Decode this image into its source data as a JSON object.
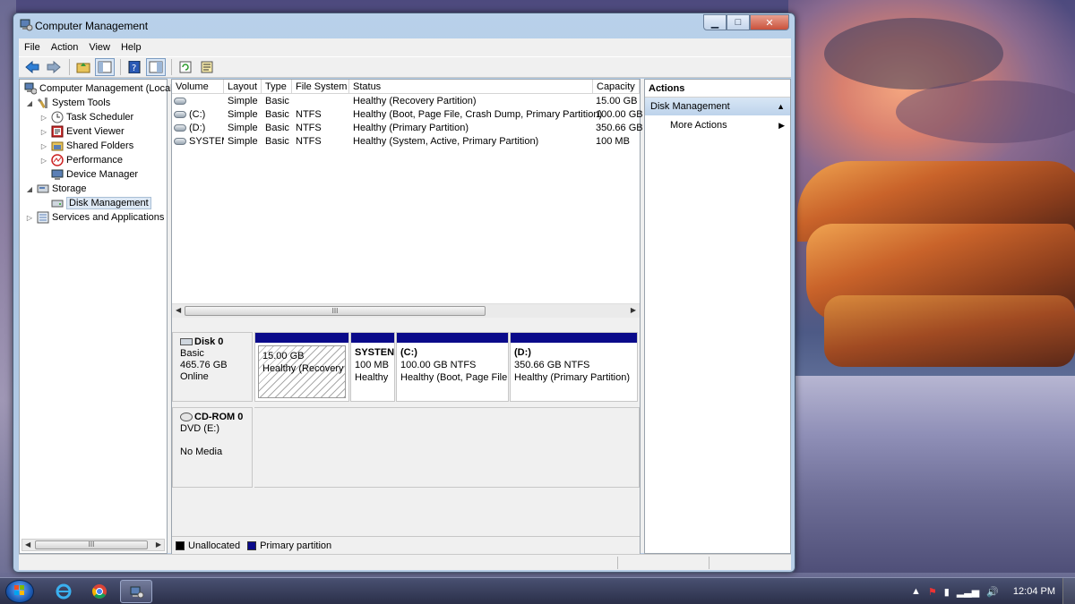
{
  "window": {
    "title": "Computer Management",
    "controls": {
      "minimize": "▁",
      "maximize": "□",
      "close": "✕"
    }
  },
  "menu": [
    "File",
    "Action",
    "View",
    "Help"
  ],
  "toolbar_icons": [
    "back-arrow-icon",
    "forward-arrow-icon",
    "up-folder-icon",
    "show-hide-tree-icon",
    "help-icon",
    "properties-icon",
    "refresh-icon",
    "export-icon"
  ],
  "tree": {
    "root": "Computer Management (Local",
    "items": [
      {
        "label": "System Tools",
        "level": 1,
        "expanded": true
      },
      {
        "label": "Task Scheduler",
        "level": 2
      },
      {
        "label": "Event Viewer",
        "level": 2
      },
      {
        "label": "Shared Folders",
        "level": 2
      },
      {
        "label": "Performance",
        "level": 2
      },
      {
        "label": "Device Manager",
        "level": 2
      },
      {
        "label": "Storage",
        "level": 1,
        "expanded": true
      },
      {
        "label": "Disk Management",
        "level": 2,
        "selected": true
      },
      {
        "label": "Services and Applications",
        "level": 1
      }
    ]
  },
  "volume_list": {
    "columns": [
      "Volume",
      "Layout",
      "Type",
      "File System",
      "Status",
      "Capacity"
    ],
    "rows": [
      {
        "volume": "",
        "layout": "Simple",
        "type": "Basic",
        "fs": "",
        "status": "Healthy (Recovery Partition)",
        "capacity": "15.00 GB"
      },
      {
        "volume": "(C:)",
        "layout": "Simple",
        "type": "Basic",
        "fs": "NTFS",
        "status": "Healthy (Boot, Page File, Crash Dump, Primary Partition)",
        "capacity": "100.00 GB"
      },
      {
        "volume": "(D:)",
        "layout": "Simple",
        "type": "Basic",
        "fs": "NTFS",
        "status": "Healthy (Primary Partition)",
        "capacity": "350.66 GB"
      },
      {
        "volume": "SYSTEM",
        "layout": "Simple",
        "type": "Basic",
        "fs": "NTFS",
        "status": "Healthy (System, Active, Primary Partition)",
        "capacity": "100 MB"
      }
    ],
    "scroll_grip": "III"
  },
  "disks": {
    "disk0": {
      "name": "Disk 0",
      "type": "Basic",
      "size": "465.76 GB",
      "state": "Online",
      "partitions": [
        {
          "line1": "",
          "line2": "15.00 GB",
          "line3": "Healthy (Recovery P"
        },
        {
          "line1": "SYSTEN",
          "line2": "100 MB",
          "line3": "Healthy"
        },
        {
          "line1": "(C:)",
          "line2": "100.00 GB NTFS",
          "line3": "Healthy (Boot, Page File,"
        },
        {
          "line1": "(D:)",
          "line2": "350.66 GB NTFS",
          "line3": "Healthy (Primary Partition)"
        }
      ]
    },
    "cdrom0": {
      "name": "CD-ROM 0",
      "type": "DVD (E:)",
      "state": "No Media"
    }
  },
  "legend": {
    "unallocated": "Unallocated",
    "primary": "Primary partition",
    "unallocated_color": "#000000",
    "primary_color": "#0a0a8a"
  },
  "actions": {
    "header": "Actions",
    "section": "Disk Management",
    "items": [
      "More Actions"
    ]
  },
  "tree_scroll_grip": "III",
  "taskbar": {
    "pinned": [
      "internet-explorer-icon",
      "chrome-icon",
      "computer-management-icon"
    ],
    "clock": "12:04 PM"
  }
}
